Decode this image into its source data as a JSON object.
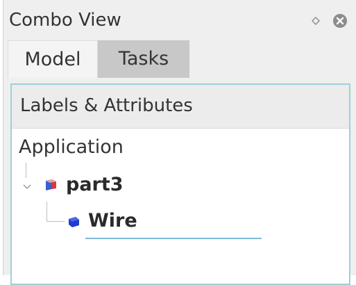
{
  "window": {
    "title": "Combo View"
  },
  "tabs": [
    {
      "label": "Model",
      "active": true
    },
    {
      "label": "Tasks",
      "active": false
    }
  ],
  "tree": {
    "header": "Labels & Attributes",
    "root": "Application",
    "items": [
      {
        "label": "part3",
        "icon": "part-icon",
        "expanded": true
      },
      {
        "label": "Wire",
        "icon": "wire-shape-icon"
      }
    ]
  },
  "colors": {
    "accent_border": "#9fcfd8",
    "edit_underline": "#7fb8d6",
    "wire_icon": "#1f3bd0",
    "part_icon_red": "#d63b3b",
    "part_icon_blue": "#3a5fcf"
  }
}
